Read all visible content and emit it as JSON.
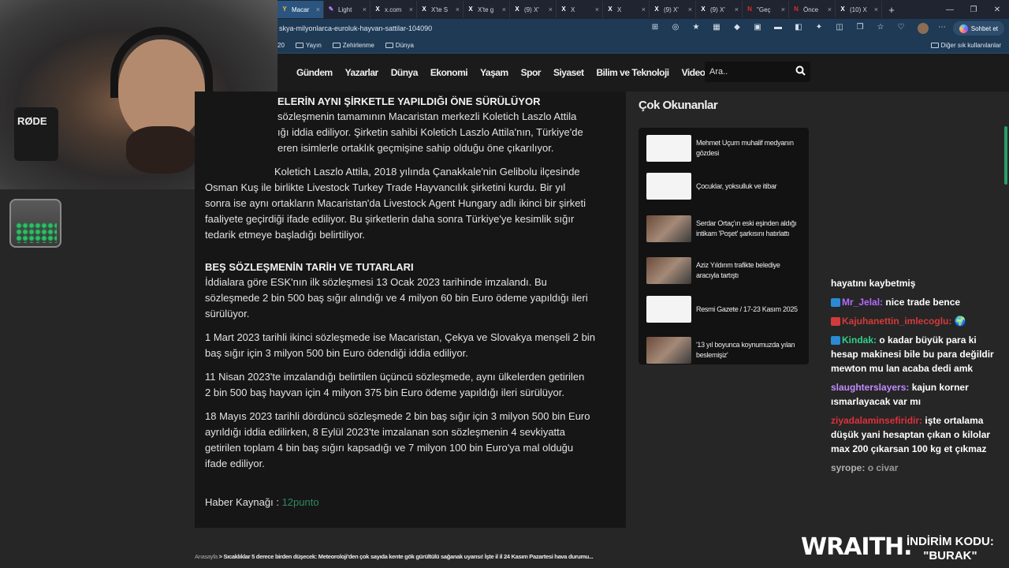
{
  "browser": {
    "tabs": [
      {
        "label": "Macar",
        "icon": "site-favicon",
        "active": true
      },
      {
        "label": "Light",
        "icon": "pen-icon"
      },
      {
        "label": "x.com",
        "icon": "x-icon"
      },
      {
        "label": "X'te S",
        "icon": "x-icon"
      },
      {
        "label": "X'te g",
        "icon": "x-icon"
      },
      {
        "label": "(9) X'",
        "icon": "x-icon"
      },
      {
        "label": "X",
        "icon": "x-icon"
      },
      {
        "label": "X",
        "icon": "x-icon"
      },
      {
        "label": "(9) X'",
        "icon": "x-icon"
      },
      {
        "label": "(9) X'",
        "icon": "x-icon"
      },
      {
        "label": "\"Geç",
        "icon": "news-icon"
      },
      {
        "label": "Önce",
        "icon": "news-icon"
      },
      {
        "label": "(10) X",
        "icon": "x-icon"
      }
    ],
    "url": "skya-milyonlarca-euroluk-hayvan-sattilar-104090",
    "chat_button": "Sohbet et",
    "bookmarks": [
      "20",
      "Yayın",
      "Zehirlenme",
      "Dünya"
    ],
    "other_bookmarks": "Diğer sık kullanılanlar"
  },
  "site": {
    "nav": [
      "Gündem",
      "Yazarlar",
      "Dünya",
      "Ekonomi",
      "Yaşam",
      "Spor",
      "Siyaset",
      "Bilim ve Teknoloji",
      "Video"
    ],
    "search_placeholder": "Ara.."
  },
  "article": {
    "heading1": "ELERİN AYNI ŞİRKETLE YAPILDIĞI ÖNE SÜRÜLÜYOR",
    "p1_lines": [
      "sözleşmenin tamamının Macaristan merkezli Koletich Laszlo Attila",
      "ığı iddia ediliyor. Şirketin sahibi Koletich Laszlo Attila'nın, Türkiye'de",
      "eren isimlerle ortaklık geçmişine sahip olduğu öne çıkarılıyor."
    ],
    "p2_lines": [
      "Koletich Laszlo Attila, 2018 yılında Çanakkale'nin Gelibolu ilçesinde",
      "Osman Kuş ile birlikte Livestock Turkey Trade Hayvancılık şirketini kurdu. Bir yıl",
      "sonra ise aynı ortakların Macaristan'da Livestock Agent Hungary adlı ikinci bir şirketi",
      "faaliyete geçirdiği ifade ediliyor. Bu şirketlerin daha sonra Türkiye'ye kesimlik sığır",
      "tedarik etmeye başladığı belirtiliyor."
    ],
    "heading2": "BEŞ SÖZLEŞMENİN TARİH VE TUTARLARI",
    "p3_lines": [
      "İddialara göre ESK'nın ilk sözleşmesi 13 Ocak 2023 tarihinde imzalandı. Bu",
      "sözleşmede 2 bin 500 baş sığır alındığı ve 4 milyon 60 bin Euro ödeme yapıldığı ileri",
      "sürülüyor."
    ],
    "p4_lines": [
      "1 Mart 2023 tarihli ikinci sözleşmede ise Macaristan, Çekya ve Slovakya menşeli 2 bin",
      "baş sığır için 3 milyon 500 bin Euro ödendiği iddia ediliyor."
    ],
    "p5_lines": [
      "11 Nisan 2023'te imzalandığı belirtilen üçüncü sözleşmede, aynı ülkelerden getirilen",
      "2 bin 500 baş hayvan için 4 milyon 375 bin Euro ödeme yapıldığı ileri sürülüyor."
    ],
    "p6_lines": [
      "18 Mayıs 2023 tarihli dördüncü sözleşmede 2 bin baş sığır için 3 milyon 500 bin Euro",
      "ayrıldığı iddia edilirken, 8 Eylül 2023'te imzalanan son sözleşmenin 4 sevkiyatta",
      "getirilen toplam 4 bin baş sığırı kapsadığı ve 7 milyon 100 bin Euro'ya mal olduğu",
      "ifade ediliyor."
    ],
    "source_label": "Haber Kaynağı :",
    "source_link": "12punto"
  },
  "sidebar": {
    "title": "Çok Okunanlar",
    "items": [
      {
        "title": "Mehmet Uçum muhalif medyanın gözdesi",
        "thumb": "author-thumb"
      },
      {
        "title": "Çocuklar, yoksulluk ve itibar",
        "thumb": "author-thumb"
      },
      {
        "title": "Serdar Ortaç'ın eski eşinden aldığı intikam 'Poşet' şarkısını hatırlattı",
        "thumb": "photo-thumb"
      },
      {
        "title": "Aziz Yıldırım trafikte belediye aracıyla tartıştı",
        "thumb": "photo-thumb"
      },
      {
        "title": "Resmi Gazete / 17-23 Kasım 2025",
        "thumb": "author-thumb"
      },
      {
        "title": "'13 yıl boyunca koynumuzda yılan beslemişiz'",
        "thumb": "photo-thumb"
      }
    ]
  },
  "breadcrumb": {
    "home": "Anasayfa",
    "current": "> Sıcaklıklar 5 derece birden düşecek: Meteoroloji'den çok sayıda kente gök gürültülü sağanak uyarısı! İşte il il 24 Kasım Pazartesi hava durumu..."
  },
  "chat": [
    {
      "user": "",
      "text": "hayatını kaybetmiş",
      "color": "#ffffff"
    },
    {
      "user": "Mr_Jelal:",
      "text": "nice trade bence",
      "color": "#b36bff"
    },
    {
      "user": "Kajuhanettin_imlecoglu:",
      "text": "🌍",
      "color": "#d43a3a"
    },
    {
      "user": "Kindak:",
      "text": "o kadar büyük para ki hesap makinesi bile bu para değildir mewton mu lan acaba dedi amk",
      "color": "#2fd18a"
    },
    {
      "user": "slaughterslayers:",
      "text": "kajun korner ısmarlayacak var mı",
      "color": "#c18cff"
    },
    {
      "user": "ziyadalaminsefiridir:",
      "text": "işte ortalama düşük yani hesaptan çıkan o kilolar max 200 çıkarsan 100 kg et çıkmaz",
      "color": "#e0303b"
    },
    {
      "user": "syrope:",
      "text": "o civar",
      "color": "#b0b0b0"
    }
  ],
  "overlay": {
    "mic_label": "RØDE",
    "brand": "WRAITH.",
    "promo_line1": "İNDİRİM KODU:",
    "promo_line2": "\"BURAK\""
  }
}
